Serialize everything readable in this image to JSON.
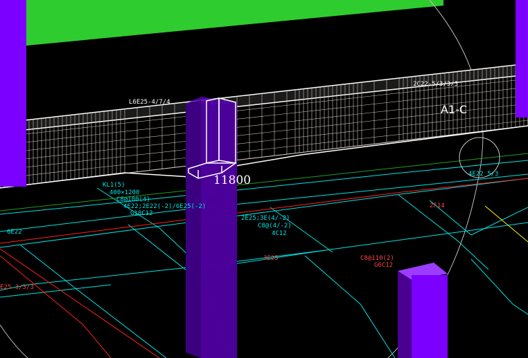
{
  "colors": {
    "background": "#000000",
    "slab": "#2ecc2e",
    "column_front": "#7b00ff",
    "column_side": "#4a0090",
    "column_top": "#9c3cff",
    "beam_mesh": "#e6d8d0",
    "grid_lines": "#00e5e5",
    "red_lines": "#ff2020",
    "green_lines": "#1fa01f",
    "cyan_text": "#00e5e5",
    "red_text": "#ff4444",
    "yellow_line": "#ffff00"
  },
  "labels": {
    "dimension": "11800",
    "axis_tag": "A1-C",
    "beam_left_line1": "KL1(5)",
    "beam_left_line2": "400×1200",
    "beam_left_line3": "C8@100(4)",
    "beam_left_line4": "4E22;2E22(-2)/6E25(-2)",
    "beam_left_line5": "G10C12",
    "beam_mid_line1": "2E25;3E(4/-2)",
    "beam_mid_line2": "C8@(4/-2)",
    "beam_mid_line3": "4C12",
    "beam_right_line1": "C8@110(2)",
    "beam_right_line2": "G6C12",
    "tag_2f14": "2F14",
    "tag_2e25": "3E25",
    "tag_6e22": "6E22",
    "tag_left": "E25 3/3/3",
    "tag_right": "4E22 5/3",
    "mesh_top_left": "L6E25-4/7/4",
    "mesh_top_right": "2C22-5/3/3/3"
  },
  "icons": {
    "view_cube_circle": "circle-marker-icon"
  }
}
